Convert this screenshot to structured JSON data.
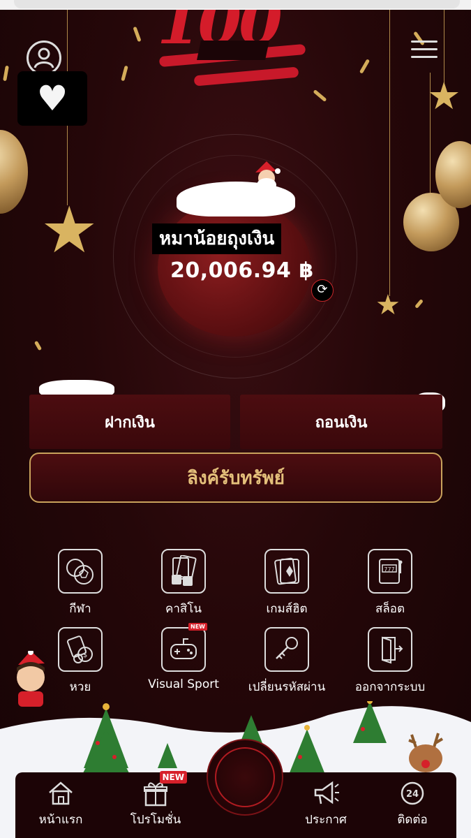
{
  "header": {
    "logo_text": "100",
    "account_name": "หมาน้อยถุงเงิน",
    "balance": "20,006.94 ฿"
  },
  "actions": {
    "deposit": "ฝากเงิน",
    "withdraw": "ถอนเงิน",
    "claim_link": "ลิงค์รับทรัพย์"
  },
  "menu_grid": [
    {
      "label": "กีฬา",
      "icon": "sports-balls-icon"
    },
    {
      "label": "คาสิโน",
      "icon": "casino-cards-dice-icon"
    },
    {
      "label": "เกมส์ฮิต",
      "icon": "hit-games-cards-icon"
    },
    {
      "label": "สล็อต",
      "icon": "slot-machine-icon"
    },
    {
      "label": "หวย",
      "icon": "lottery-balls-icon"
    },
    {
      "label": "Visual Sport",
      "icon": "gamepad-icon",
      "badge": "NEW"
    },
    {
      "label": "เปลี่ยนรหัสผ่าน",
      "icon": "key-icon"
    },
    {
      "label": "ออกจากระบบ",
      "icon": "logout-door-icon"
    }
  ],
  "bottom_nav": [
    {
      "label": "หน้าแรก",
      "icon": "home-icon"
    },
    {
      "label": "โปรโมชั่น",
      "icon": "gift-icon",
      "badge": "NEW"
    },
    {
      "label": "ประกาศ",
      "icon": "megaphone-icon"
    },
    {
      "label": "ติดต่อ",
      "icon": "support-24-icon",
      "icon_text": "24"
    }
  ],
  "colors": {
    "background": "#1a0608",
    "accent_red": "#c8192a",
    "gold": "#c9a25c",
    "button_fill": "#4c0d10"
  }
}
